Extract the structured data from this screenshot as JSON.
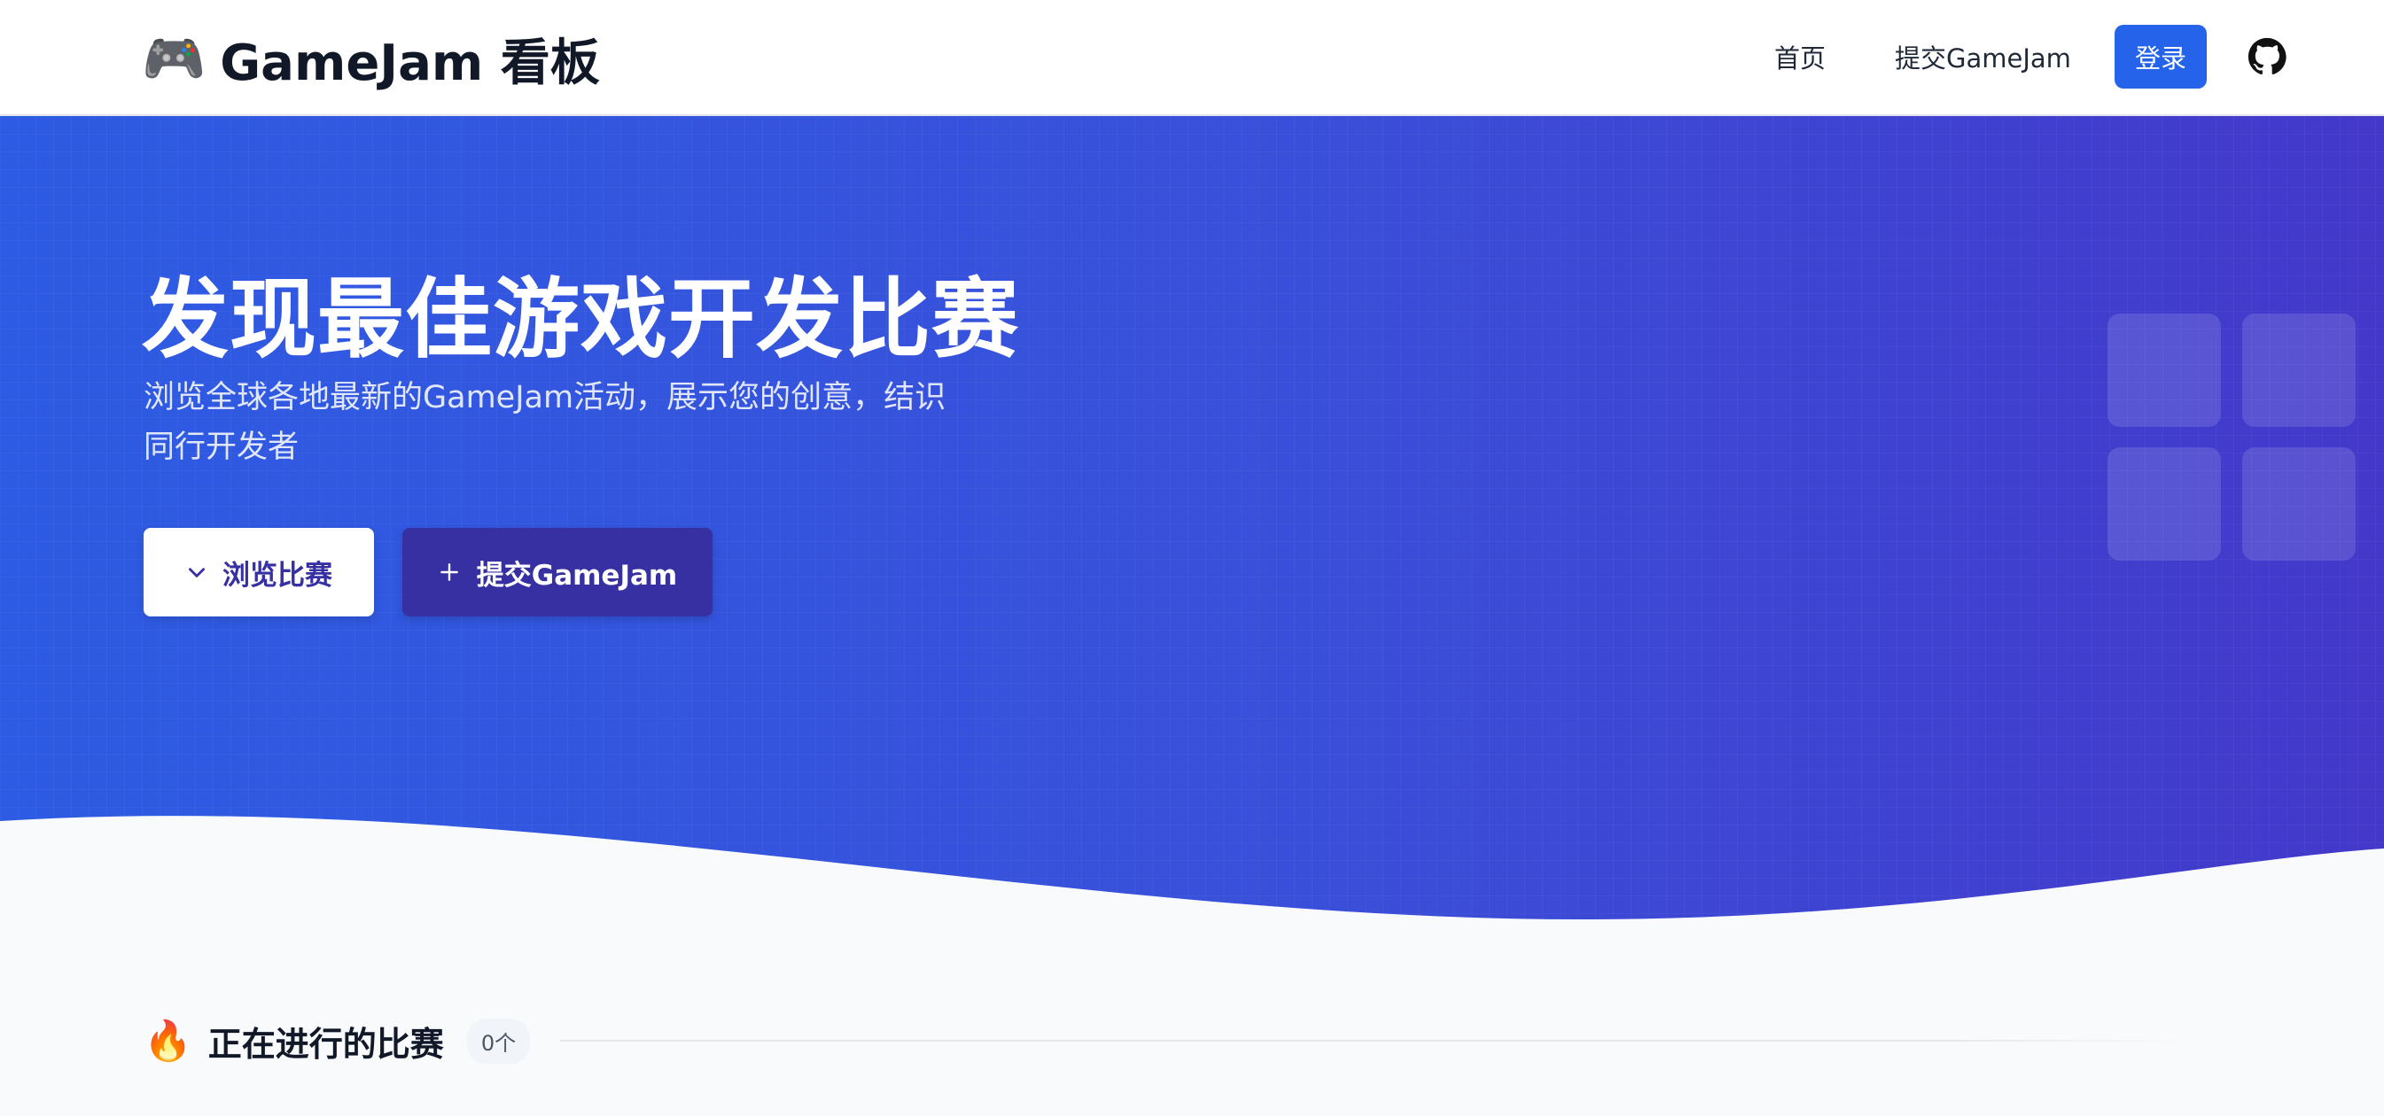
{
  "header": {
    "brand_icon": "🎮",
    "brand_title": "GameJam 看板",
    "nav": {
      "home": "首页",
      "submit": "提交GameJam"
    },
    "login_label": "登录",
    "github_icon": "github-icon"
  },
  "hero": {
    "title": "发现最佳游戏开发比赛",
    "subtitle": "浏览全球各地最新的GameJam活动，展示您的创意，结识同行开发者",
    "browse_icon": "chevron-down-icon",
    "browse_label": "浏览比赛",
    "submit_icon": "plus-icon",
    "submit_label": "提交GameJam"
  },
  "section": {
    "icon": "🔥",
    "title": "正在进行的比赛",
    "count": "0个"
  },
  "colors": {
    "primary": "#2563eb",
    "indigo_dark": "#3730a3",
    "hero_start": "#2d5be3",
    "hero_end": "#4338ca"
  }
}
